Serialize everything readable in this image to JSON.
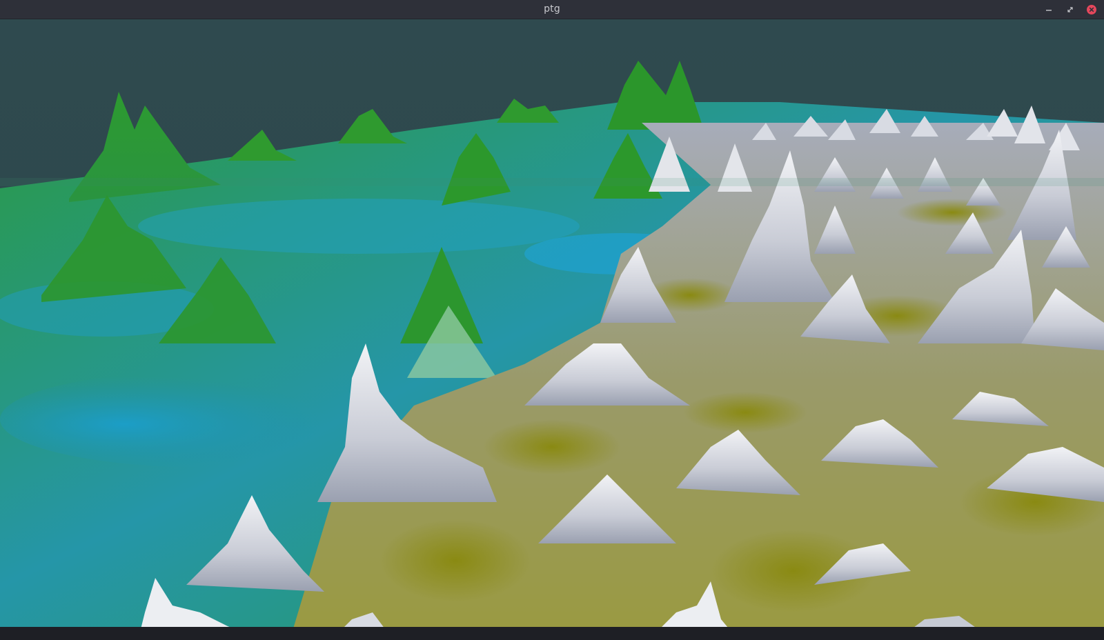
{
  "window": {
    "title": "ptg"
  },
  "controls": {
    "minimize_icon": "minimize-icon",
    "restore_icon": "restore-icon",
    "close_icon": "close-icon"
  },
  "colors": {
    "titlebar": "#2e3039",
    "title_text": "#c8c9ce",
    "close_accent": "#e5475c",
    "sky": "#2e4a4e",
    "terrain_low": "#1e9bbd",
    "terrain_mid": "#2e9a33",
    "terrain_sand": "#8c8c1a",
    "terrain_snow": "#e6e8ee"
  }
}
